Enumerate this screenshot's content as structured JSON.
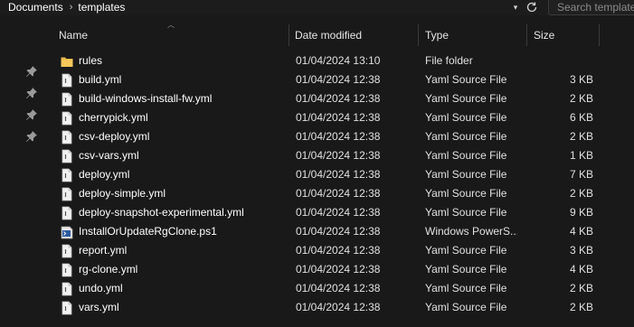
{
  "breadcrumb": {
    "items": [
      "Documents",
      "templates"
    ]
  },
  "search": {
    "placeholder": "Search templates"
  },
  "columns": {
    "name": "Name",
    "date": "Date modified",
    "type": "Type",
    "size": "Size"
  },
  "files": [
    {
      "icon": "folder-icon",
      "name": "rules",
      "date": "01/04/2024 13:10",
      "type": "File folder",
      "size": ""
    },
    {
      "icon": "file-icon",
      "name": "build.yml",
      "date": "01/04/2024 12:38",
      "type": "Yaml Source File",
      "size": "3 KB"
    },
    {
      "icon": "file-icon",
      "name": "build-windows-install-fw.yml",
      "date": "01/04/2024 12:38",
      "type": "Yaml Source File",
      "size": "2 KB"
    },
    {
      "icon": "file-icon",
      "name": "cherrypick.yml",
      "date": "01/04/2024 12:38",
      "type": "Yaml Source File",
      "size": "6 KB"
    },
    {
      "icon": "file-icon",
      "name": "csv-deploy.yml",
      "date": "01/04/2024 12:38",
      "type": "Yaml Source File",
      "size": "2 KB"
    },
    {
      "icon": "file-icon",
      "name": "csv-vars.yml",
      "date": "01/04/2024 12:38",
      "type": "Yaml Source File",
      "size": "1 KB"
    },
    {
      "icon": "file-icon",
      "name": "deploy.yml",
      "date": "01/04/2024 12:38",
      "type": "Yaml Source File",
      "size": "7 KB"
    },
    {
      "icon": "file-icon",
      "name": "deploy-simple.yml",
      "date": "01/04/2024 12:38",
      "type": "Yaml Source File",
      "size": "2 KB"
    },
    {
      "icon": "file-icon",
      "name": "deploy-snapshot-experimental.yml",
      "date": "01/04/2024 12:38",
      "type": "Yaml Source File",
      "size": "9 KB"
    },
    {
      "icon": "powershell-script-icon",
      "name": "InstallOrUpdateRgClone.ps1",
      "date": "01/04/2024 12:38",
      "type": "Windows PowerS...",
      "size": "4 KB"
    },
    {
      "icon": "file-icon",
      "name": "report.yml",
      "date": "01/04/2024 12:38",
      "type": "Yaml Source File",
      "size": "3 KB"
    },
    {
      "icon": "file-icon",
      "name": "rg-clone.yml",
      "date": "01/04/2024 12:38",
      "type": "Yaml Source File",
      "size": "4 KB"
    },
    {
      "icon": "file-icon",
      "name": "undo.yml",
      "date": "01/04/2024 12:38",
      "type": "Yaml Source File",
      "size": "2 KB"
    },
    {
      "icon": "file-icon",
      "name": "vars.yml",
      "date": "01/04/2024 12:38",
      "type": "Yaml Source File",
      "size": "2 KB"
    }
  ],
  "colors": {
    "background": "#191919",
    "folder": "#e8b84b",
    "text": "#ffffff"
  }
}
